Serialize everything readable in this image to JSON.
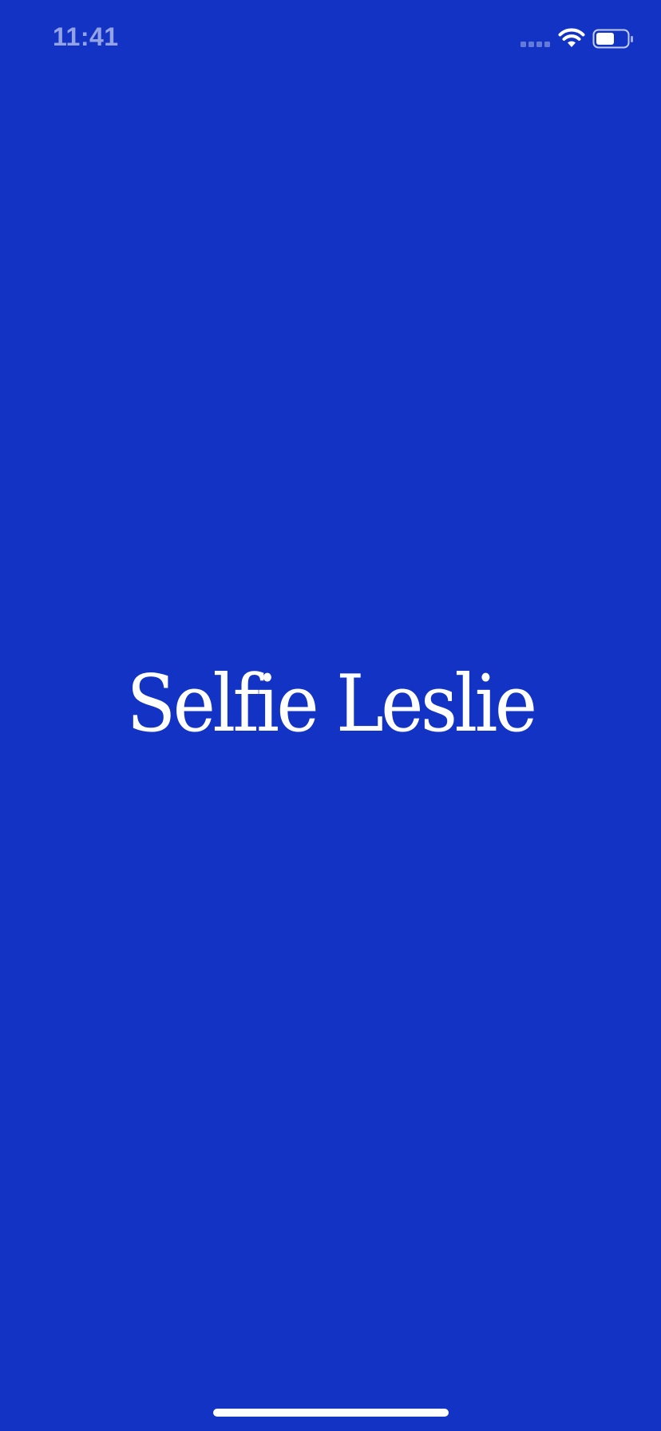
{
  "status_bar": {
    "time": "11:41",
    "signal_icon": "cellular-signal-icon",
    "wifi_icon": "wifi-icon",
    "battery_icon": "battery-icon",
    "battery_level": 0.6
  },
  "splash": {
    "logo_text": "Selfie Leslie"
  },
  "colors": {
    "background": "#1233C4",
    "foreground": "#FFFFFF"
  }
}
